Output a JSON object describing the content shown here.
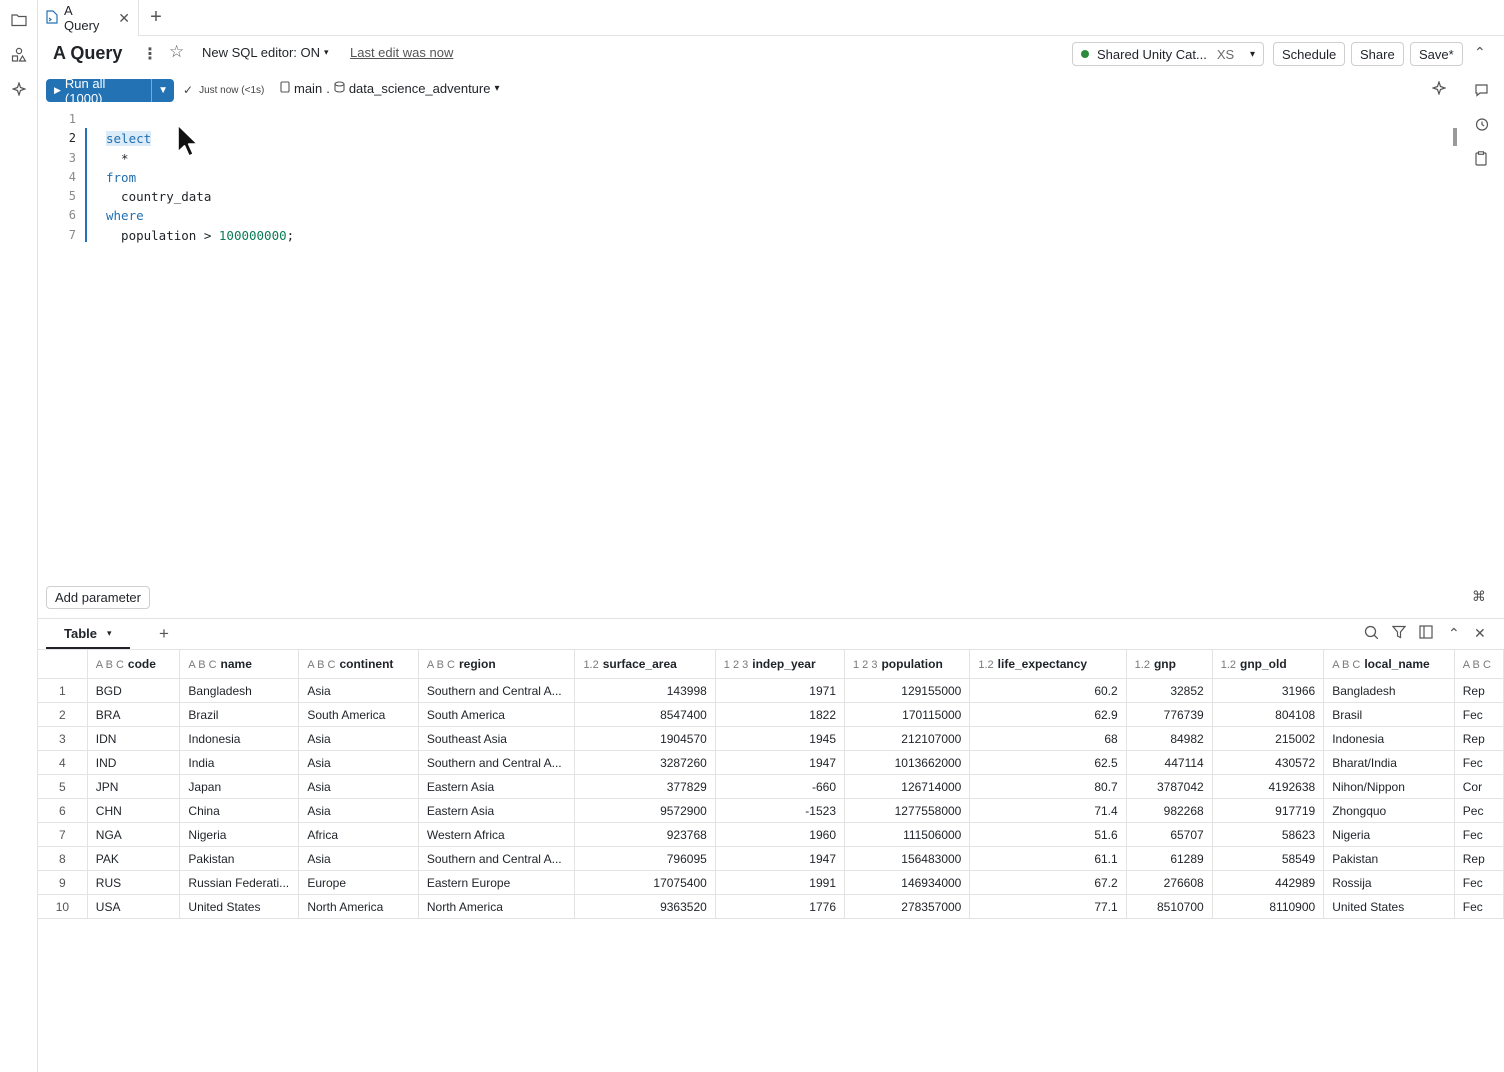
{
  "tab": {
    "label": "A Query"
  },
  "header": {
    "title": "A Query",
    "editor_toggle": "New SQL editor: ON",
    "last_edit": "Last edit was now",
    "warehouse_name": "Shared Unity Cat...",
    "warehouse_size": "XS",
    "schedule_label": "Schedule",
    "share_label": "Share",
    "save_label": "Save*"
  },
  "toolbar": {
    "run_label": "Run all (1000)",
    "status": "Just now (<1s)",
    "catalog": "main",
    "schema": "data_science_adventure"
  },
  "editor": {
    "line_numbers": [
      "1",
      "2",
      "3",
      "4",
      "5",
      "6",
      "7"
    ],
    "lines": [
      {
        "kw": "",
        "text": ""
      },
      {
        "kw": "select",
        "text": ""
      },
      {
        "kw": "",
        "text": "  *"
      },
      {
        "kw": "from",
        "text": ""
      },
      {
        "kw": "",
        "text": "  country_data"
      },
      {
        "kw": "where",
        "text": ""
      },
      {
        "kw": "",
        "text": "  population > ",
        "num": "100000000",
        "tail": ";"
      }
    ]
  },
  "add_parameter_label": "Add parameter",
  "results": {
    "tab_label": "Table",
    "columns": [
      {
        "type": "A B C",
        "name": "code"
      },
      {
        "type": "A B C",
        "name": "name"
      },
      {
        "type": "A B C",
        "name": "continent"
      },
      {
        "type": "A B C",
        "name": "region"
      },
      {
        "type": "1.2",
        "name": "surface_area"
      },
      {
        "type": "1 2 3",
        "name": "indep_year"
      },
      {
        "type": "1 2 3",
        "name": "population"
      },
      {
        "type": "1.2",
        "name": "life_expectancy"
      },
      {
        "type": "1.2",
        "name": "gnp"
      },
      {
        "type": "1.2",
        "name": "gnp_old"
      },
      {
        "type": "A B C",
        "name": "local_name"
      },
      {
        "type": "A B C",
        "name": ""
      }
    ],
    "rows": [
      [
        "1",
        "BGD",
        "Bangladesh",
        "Asia",
        "Southern and Central A...",
        "143998",
        "1971",
        "129155000",
        "60.2",
        "32852",
        "31966",
        "Bangladesh",
        "Rep"
      ],
      [
        "2",
        "BRA",
        "Brazil",
        "South America",
        "South America",
        "8547400",
        "1822",
        "170115000",
        "62.9",
        "776739",
        "804108",
        "Brasil",
        "Fec"
      ],
      [
        "3",
        "IDN",
        "Indonesia",
        "Asia",
        "Southeast Asia",
        "1904570",
        "1945",
        "212107000",
        "68",
        "84982",
        "215002",
        "Indonesia",
        "Rep"
      ],
      [
        "4",
        "IND",
        "India",
        "Asia",
        "Southern and Central A...",
        "3287260",
        "1947",
        "1013662000",
        "62.5",
        "447114",
        "430572",
        "Bharat/India",
        "Fec"
      ],
      [
        "5",
        "JPN",
        "Japan",
        "Asia",
        "Eastern Asia",
        "377829",
        "-660",
        "126714000",
        "80.7",
        "3787042",
        "4192638",
        "Nihon/Nippon",
        "Cor"
      ],
      [
        "6",
        "CHN",
        "China",
        "Asia",
        "Eastern Asia",
        "9572900",
        "-1523",
        "1277558000",
        "71.4",
        "982268",
        "917719",
        "Zhongquo",
        "Pec"
      ],
      [
        "7",
        "NGA",
        "Nigeria",
        "Africa",
        "Western Africa",
        "923768",
        "1960",
        "111506000",
        "51.6",
        "65707",
        "58623",
        "Nigeria",
        "Fec"
      ],
      [
        "8",
        "PAK",
        "Pakistan",
        "Asia",
        "Southern and Central A...",
        "796095",
        "1947",
        "156483000",
        "61.1",
        "61289",
        "58549",
        "Pakistan",
        "Rep"
      ],
      [
        "9",
        "RUS",
        "Russian Federati...",
        "Europe",
        "Eastern Europe",
        "17075400",
        "1991",
        "146934000",
        "67.2",
        "276608",
        "442989",
        "Rossija",
        "Fec"
      ],
      [
        "10",
        "USA",
        "United States",
        "North America",
        "North America",
        "9363520",
        "1776",
        "278357000",
        "77.1",
        "8510700",
        "8110900",
        "United States",
        "Fec"
      ]
    ]
  },
  "colors": {
    "accent": "#2272b4",
    "status_green": "#2b8a3e"
  }
}
